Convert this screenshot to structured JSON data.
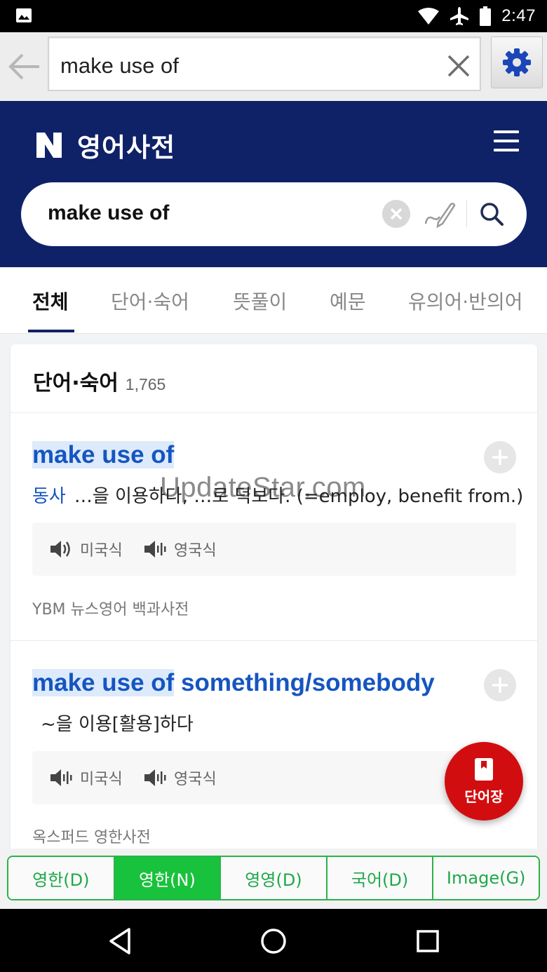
{
  "status_bar": {
    "time": "2:47"
  },
  "toolbar": {
    "query": "make use of"
  },
  "header": {
    "brand_letter": "N",
    "title": "영어사전"
  },
  "search": {
    "query": "make use of"
  },
  "tabs": [
    {
      "label": "전체",
      "active": true
    },
    {
      "label": "단어·숙어",
      "active": false
    },
    {
      "label": "뜻풀이",
      "active": false
    },
    {
      "label": "예문",
      "active": false
    },
    {
      "label": "유의어·반의어",
      "active": false
    }
  ],
  "section": {
    "title": "단어·숙어",
    "count": "1,765"
  },
  "entries": [
    {
      "headword_match": "make use of",
      "headword_rest": "",
      "pos": "동사",
      "meaning": "…을 이용하다, …로 덕보다. (=employ, benefit from.)",
      "audio_us": "미국식",
      "audio_uk": "영국식",
      "source": "YBM 뉴스영어 백과사전"
    },
    {
      "headword_match": "make use of",
      "headword_rest": " something/somebody",
      "pos": "",
      "meaning": "~을 이용[활용]하다",
      "audio_us": "미국식",
      "audio_uk": "영국식",
      "source": "옥스퍼드 영한사전"
    }
  ],
  "watermark": "UpdateStar.com",
  "fab": {
    "label": "단어장"
  },
  "dict_tabs": [
    {
      "label": "영한(D)",
      "active": false
    },
    {
      "label": "영한(N)",
      "active": true
    },
    {
      "label": "영영(D)",
      "active": false
    },
    {
      "label": "국어(D)",
      "active": false
    },
    {
      "label": "Image(G)",
      "active": false
    }
  ],
  "colors": {
    "naver_navy": "#0f2167",
    "link_blue": "#1555c0",
    "highlight": "#dceafb",
    "fab_red": "#d20d10",
    "dict_green": "#19c23c"
  }
}
